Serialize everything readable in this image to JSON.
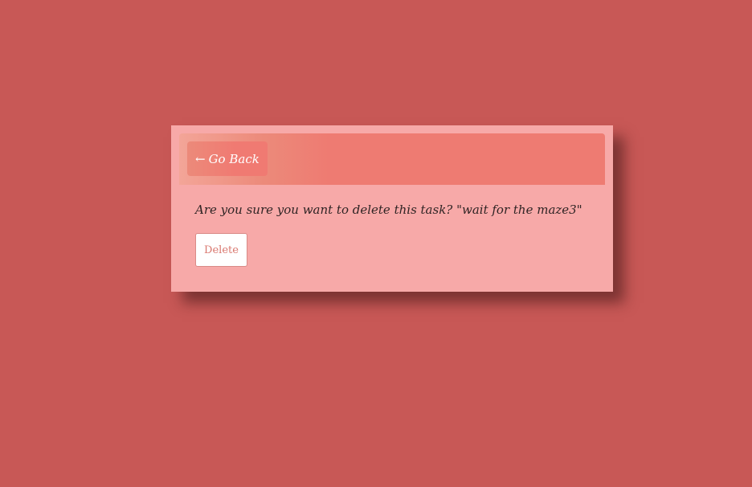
{
  "nav": {
    "back_arrow": "←",
    "back_label": "Go Back"
  },
  "dialog": {
    "question": "Are you sure you want to delete this task? \"wait for the maze3\"",
    "delete_label": "Delete"
  },
  "colors": {
    "page_background": "#c85856",
    "card_background": "#f7a9a8",
    "header_accent": "#ee7b72",
    "delete_text": "#d9786f"
  }
}
